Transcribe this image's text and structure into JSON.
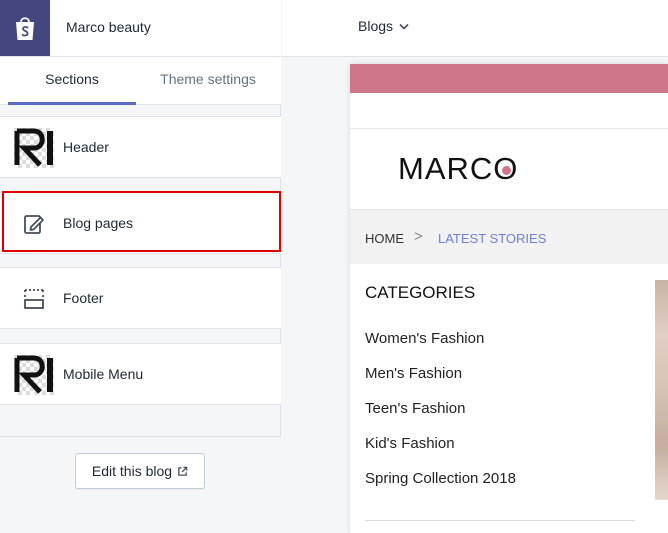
{
  "shop": {
    "name": "Marco beauty",
    "logo_icon": "shopify-bag-icon",
    "logo_color": "#43467f"
  },
  "tabs": [
    {
      "label": "Sections",
      "active": true
    },
    {
      "label": "Theme settings",
      "active": false
    }
  ],
  "sections": [
    {
      "label": "Header",
      "icon": "logo-thumbnail"
    },
    {
      "label": "Blog pages",
      "icon": "edit-icon",
      "highlighted": true
    },
    {
      "label": "Footer",
      "icon": "footer-layout-icon"
    },
    {
      "label": "Mobile Menu",
      "icon": "logo-thumbnail"
    }
  ],
  "edit_button": {
    "label": "Edit this blog",
    "icon": "external-link-icon"
  },
  "page_select": {
    "value": "Blogs",
    "icon": "chevron-down-icon"
  },
  "preview": {
    "brand": {
      "prefix": "MARC",
      "o": "O"
    },
    "accent_color": "#d0768a",
    "breadcrumb": {
      "home": "HOME",
      "separator": ">",
      "current": "LATEST STORIES"
    },
    "categories_title": "CATEGORIES",
    "categories": [
      "Women's Fashion",
      "Men's Fashion",
      "Teen's Fashion",
      "Kid's Fashion",
      "Spring Collection 2018"
    ]
  }
}
